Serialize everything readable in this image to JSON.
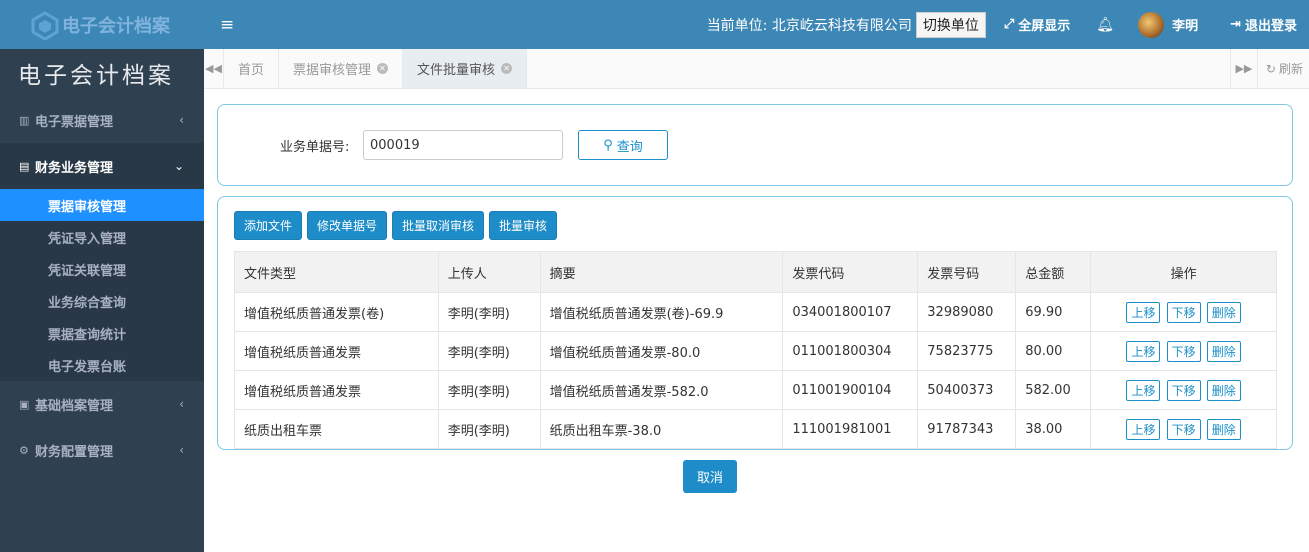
{
  "logo": {
    "text": "电子会计档案"
  },
  "app_title": "电子会计档案",
  "sidebar": {
    "groups": [
      {
        "label": "电子票据管理",
        "icon": "barcode-icon",
        "chevron": "‹"
      },
      {
        "label": "财务业务管理",
        "icon": "book-icon",
        "chevron": "⌄"
      },
      {
        "label": "基础档案管理",
        "icon": "profile-card-icon",
        "chevron": "‹"
      },
      {
        "label": "财务配置管理",
        "icon": "gear-icon",
        "chevron": "‹"
      }
    ],
    "sub_items": [
      {
        "label": "票据审核管理"
      },
      {
        "label": "凭证导入管理"
      },
      {
        "label": "凭证关联管理"
      },
      {
        "label": "业务综合查询"
      },
      {
        "label": "票据查询统计"
      },
      {
        "label": "电子发票台账"
      }
    ]
  },
  "header": {
    "unit_label": "当前单位: 北京屹云科技有限公司",
    "switch_button": "切换单位",
    "fullscreen": "全屏显示",
    "user_name": "李明",
    "logout": "退出登录"
  },
  "tabs": {
    "items": [
      {
        "label": "首页"
      },
      {
        "label": "票据审核管理"
      },
      {
        "label": "文件批量审核"
      }
    ],
    "refresh": "刷新"
  },
  "search": {
    "label": "业务单据号:",
    "value": "000019",
    "button": "查询"
  },
  "toolbar": {
    "add_file": "添加文件",
    "modify_doc_no": "修改单据号",
    "batch_cancel_review": "批量取消审核",
    "batch_review": "批量审核"
  },
  "table": {
    "headers": [
      "文件类型",
      "上传人",
      "摘要",
      "发票代码",
      "发票号码",
      "总金额",
      "操作"
    ],
    "rows": [
      [
        "增值税纸质普通发票(卷)",
        "李明(李明)",
        "增值税纸质普通发票(卷)-69.9",
        "034001800107",
        "32989080",
        "69.90"
      ],
      [
        "增值税纸质普通发票",
        "李明(李明)",
        "增值税纸质普通发票-80.0",
        "011001800304",
        "75823775",
        "80.00"
      ],
      [
        "增值税纸质普通发票",
        "李明(李明)",
        "增值税纸质普通发票-582.0",
        "011001900104",
        "50400373",
        "582.00"
      ],
      [
        "纸质出租车票",
        "李明(李明)",
        "纸质出租车票-38.0",
        "111001981001",
        "91787343",
        "38.00"
      ]
    ],
    "actions": {
      "up": "上移",
      "down": "下移",
      "delete": "删除"
    }
  },
  "cancel_button": "取消"
}
